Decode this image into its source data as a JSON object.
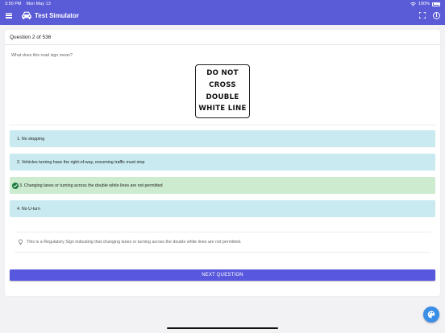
{
  "status_bar": {
    "time": "3:50 PM",
    "date": "Mon May 13",
    "battery": "100%"
  },
  "nav": {
    "title": "Test Simulator",
    "menu_icon": "menu-icon",
    "car_icon": "car-icon",
    "fullscreen_icon": "fullscreen-icon",
    "info_icon": "info-icon",
    "info_glyph": "i"
  },
  "question": {
    "header": "Question 2 of 536",
    "prompt": "What does this road sign mean?",
    "sign_lines": [
      "DO NOT",
      "CROSS",
      "DOUBLE",
      "WHITE LINE"
    ]
  },
  "options": [
    {
      "label": "1. No stopping",
      "state": "neutral"
    },
    {
      "label": "2. Vehicles turning have the right-of-way, oncoming traffic must stop",
      "state": "neutral"
    },
    {
      "label": "3. Changing lanes or turning across the double white lines are not permitted",
      "state": "correct"
    },
    {
      "label": "4. No U-turn",
      "state": "neutral"
    }
  ],
  "explanation": {
    "text": "This is a Regulatory Sign indicating that changing lanes or turning across the double white lines are not permitted.",
    "icon": "lightbulb-icon"
  },
  "next_button": {
    "label": "NEXT QUESTION"
  },
  "fab": {
    "icon": "palette-icon"
  },
  "colors": {
    "brand": "#5a5bd6",
    "option_bg": "#c8eaf0",
    "correct_bg": "#ccebcf",
    "check": "#1b7a3d",
    "button": "#5858de",
    "fab": "#3a8ee6"
  }
}
